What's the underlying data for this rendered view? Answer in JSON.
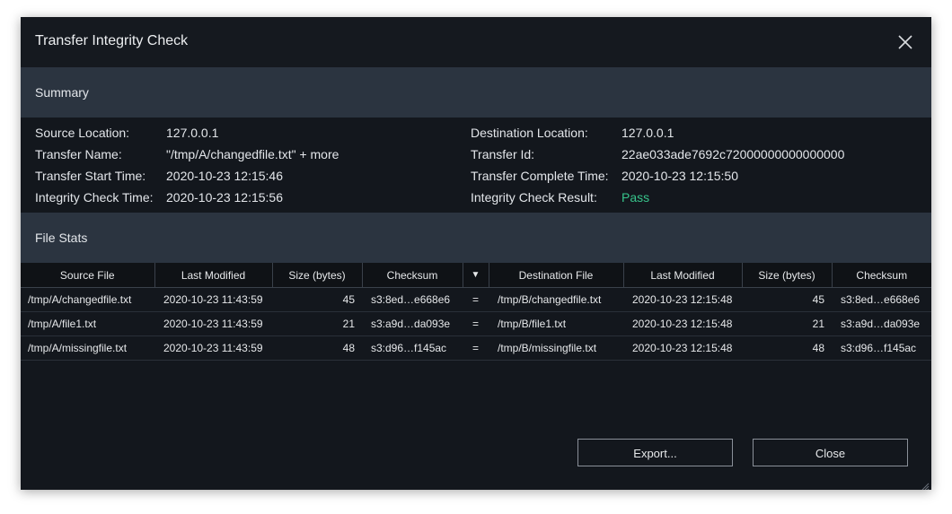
{
  "dialog": {
    "title": "Transfer Integrity Check"
  },
  "summary": {
    "header": "Summary",
    "left": [
      {
        "label": "Source Location:",
        "value": "127.0.0.1"
      },
      {
        "label": "Transfer Name:",
        "value": "\"/tmp/A/changedfile.txt\" + more"
      },
      {
        "label": "Transfer Start Time:",
        "value": "2020-10-23 12:15:46"
      },
      {
        "label": "Integrity Check Time:",
        "value": "2020-10-23 12:15:56"
      }
    ],
    "right": [
      {
        "label": "Destination Location:",
        "value": "127.0.0.1"
      },
      {
        "label": "Transfer Id:",
        "value": "22ae033ade7692c72000000000000000"
      },
      {
        "label": "Transfer Complete Time:",
        "value": "2020-10-23 12:15:50"
      },
      {
        "label": "Integrity Check Result:",
        "value": "Pass"
      }
    ]
  },
  "file_stats": {
    "header": "File Stats",
    "columns": [
      "Source File",
      "Last Modified",
      "Size (bytes)",
      "Checksum",
      "▼",
      "Destination File",
      "Last Modified",
      "Size (bytes)",
      "Checksum"
    ],
    "rows": [
      [
        "/tmp/A/changedfile.txt",
        "2020-10-23 11:43:59",
        "45",
        "s3:8ed…e668e6",
        "=",
        "/tmp/B/changedfile.txt",
        "2020-10-23 12:15:48",
        "45",
        "s3:8ed…e668e6"
      ],
      [
        "/tmp/A/file1.txt",
        "2020-10-23 11:43:59",
        "21",
        "s3:a9d…da093e",
        "=",
        "/tmp/B/file1.txt",
        "2020-10-23 12:15:48",
        "21",
        "s3:a9d…da093e"
      ],
      [
        "/tmp/A/missingfile.txt",
        "2020-10-23 11:43:59",
        "48",
        "s3:d96…f145ac",
        "=",
        "/tmp/B/missingfile.txt",
        "2020-10-23 12:15:48",
        "48",
        "s3:d96…f145ac"
      ]
    ]
  },
  "buttons": {
    "export": "Export...",
    "close": "Close"
  },
  "colors": {
    "pass": "#37c48b",
    "section_header": "#2b3440",
    "background": "#13171d"
  }
}
